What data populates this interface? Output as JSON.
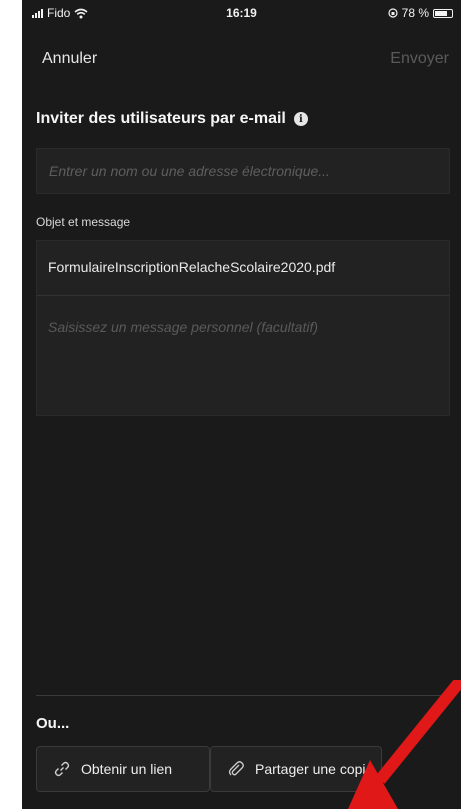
{
  "status_bar": {
    "carrier": "Fido",
    "time": "16:19",
    "battery_percent": "78 %",
    "battery_level": 0.78
  },
  "nav": {
    "cancel_label": "Annuler",
    "send_label": "Envoyer"
  },
  "invite": {
    "title": "Inviter des utilisateurs par e-mail",
    "info_icon": "info-icon",
    "email_placeholder": "Entrer un nom ou une adresse électronique..."
  },
  "message": {
    "label": "Objet et message",
    "subject_value": "FormulaireInscriptionRelacheScolaire2020.pdf",
    "message_placeholder": "Saisissez un message personnel (facultatif)"
  },
  "alternatives": {
    "heading": "Ou...",
    "get_link_label": "Obtenir un lien",
    "share_copy_label": "Partager une copie"
  },
  "colors": {
    "background": "#1a1a1a",
    "field_background": "#222222",
    "disabled_text": "#5a5a5a",
    "annotation_arrow": "#e01818"
  }
}
